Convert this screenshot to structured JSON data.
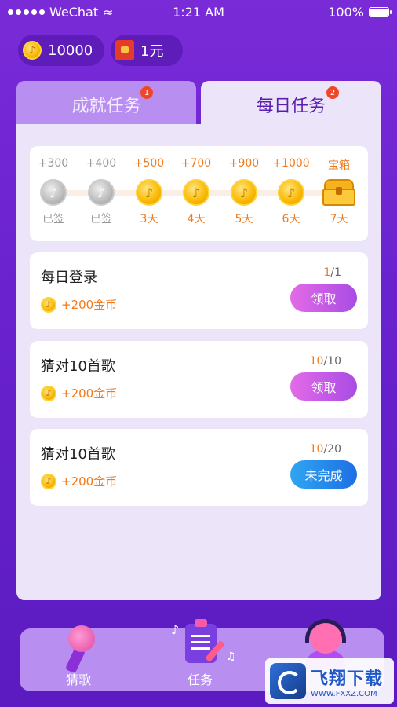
{
  "status_bar": {
    "carrier": "WeChat",
    "time": "1:21 AM",
    "battery": "100%"
  },
  "balances": {
    "coins": "10000",
    "cash": "1元"
  },
  "tabs": [
    {
      "label": "成就任务",
      "badge": "1"
    },
    {
      "label": "每日任务",
      "badge": "2"
    }
  ],
  "checkin": {
    "days": [
      {
        "amount": "+300",
        "label": "已签"
      },
      {
        "amount": "+400",
        "label": "已签"
      },
      {
        "amount": "+500",
        "label": "3天"
      },
      {
        "amount": "+700",
        "label": "4天"
      },
      {
        "amount": "+900",
        "label": "5天"
      },
      {
        "amount": "+1000",
        "label": "6天"
      },
      {
        "amount": "宝箱",
        "label": "7天"
      }
    ]
  },
  "tasks": [
    {
      "title": "每日登录",
      "reward": "+200金币",
      "progress_current": "1",
      "progress_total": "/1",
      "button": "领取"
    },
    {
      "title": "猜对10首歌",
      "reward": "+200金币",
      "progress_current": "10",
      "progress_total": "/10",
      "button": "领取"
    },
    {
      "title": "猜对10首歌",
      "reward": "+200金币",
      "progress_current": "10",
      "progress_total": "/20",
      "button": "未完成"
    }
  ],
  "nav": {
    "sing": "猜歌",
    "task": "任务"
  },
  "watermark": {
    "main": "飞翔下载",
    "url": "WWW.FXXZ.COM"
  },
  "colors": {
    "accent_orange": "#f07a1d",
    "purple": "#7a2bd8",
    "claim_button": "#c35ae6",
    "pending_button": "#2a8aeb"
  },
  "icons": [
    "music-coin-icon",
    "red-packet-icon",
    "treasure-chest-icon",
    "microphone-icon",
    "clipboard-icon",
    "headphones-avatar-icon"
  ]
}
